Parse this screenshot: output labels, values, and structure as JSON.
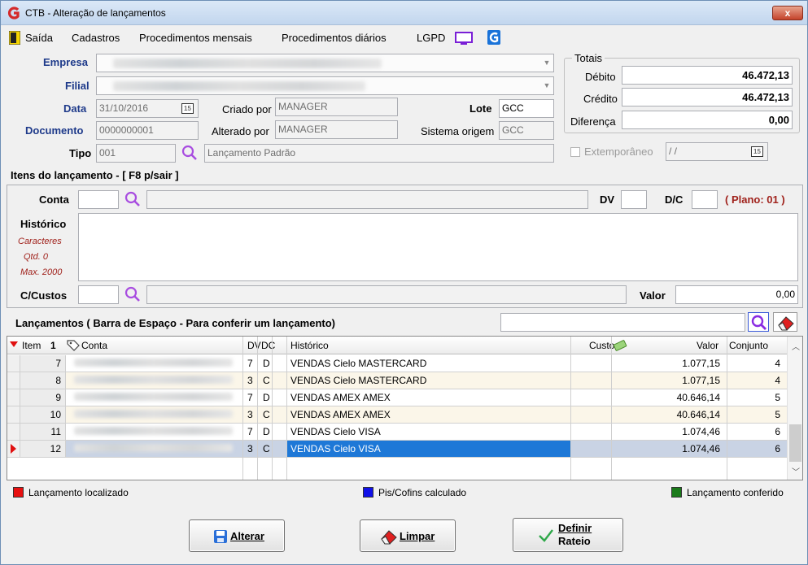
{
  "window": {
    "title": "CTB - Alteração de lançamentos",
    "close_glyph": "x"
  },
  "menu": [
    "Saída",
    "Cadastros",
    "Procedimentos mensais",
    "Procedimentos diários",
    "LGPD"
  ],
  "header": {
    "empresa_label": "Empresa",
    "filial_label": "Filial",
    "data_label": "Data",
    "data_value": "31/10/2016",
    "calendar_glyph": "15",
    "criado_por_label": "Criado por",
    "criado_por_value": "MANAGER",
    "alterado_por_label": "Alterado por",
    "alterado_por_value": "MANAGER",
    "lote_label": "Lote",
    "lote_value": "GCC",
    "sistema_origem_label": "Sistema origem",
    "sistema_origem_value": "GCC",
    "documento_label": "Documento",
    "documento_value": "0000000001",
    "tipo_label": "Tipo",
    "tipo_code": "001",
    "tipo_desc": "Lançamento Padrão"
  },
  "totais": {
    "label": "Totais",
    "debito_label": "Débito",
    "debito_value": "46.472,13",
    "credito_label": "Crédito",
    "credito_value": "46.472,13",
    "diferenca_label": "Diferença",
    "diferenca_value": "0,00",
    "extemporaneo_label": "Extemporâneo",
    "extemporaneo_date": "/ /"
  },
  "itens": {
    "section_title": "Itens do lançamento - [ F8 p/sair ]",
    "conta_label": "Conta",
    "dv_label": "DV",
    "dc_label": "D/C",
    "plano_label": "( Plano: 01 )",
    "historico_label": "Histórico",
    "caracteres_label": "Caracteres",
    "qtd_label": "Qtd. 0",
    "max_label": "Max. 2000",
    "ccustos_label": "C/Custos",
    "valor_label": "Valor",
    "valor_value": "0,00"
  },
  "lancamentos": {
    "section_title": "Lançamentos ( Barra de Espaço - Para conferir um lançamento)",
    "columns": {
      "item": "Item",
      "sort": "1",
      "conta": "Conta",
      "dv": "DV",
      "dc": "DC",
      "historico": "Histórico",
      "custo": "Custo",
      "valor": "Valor",
      "conjunto": "Conjunto"
    },
    "rows": [
      {
        "item": "7",
        "dv": "7",
        "dc": "D",
        "historico": "VENDAS Cielo MASTERCARD",
        "valor": "1.077,15",
        "conjunto": "4"
      },
      {
        "item": "8",
        "dv": "3",
        "dc": "C",
        "historico": "VENDAS Cielo MASTERCARD",
        "valor": "1.077,15",
        "conjunto": "4"
      },
      {
        "item": "9",
        "dv": "7",
        "dc": "D",
        "historico": "VENDAS AMEX AMEX",
        "valor": "40.646,14",
        "conjunto": "5"
      },
      {
        "item": "10",
        "dv": "3",
        "dc": "C",
        "historico": "VENDAS AMEX AMEX",
        "valor": "40.646,14",
        "conjunto": "5"
      },
      {
        "item": "11",
        "dv": "7",
        "dc": "D",
        "historico": "VENDAS Cielo VISA",
        "valor": "1.074,46",
        "conjunto": "6"
      },
      {
        "item": "12",
        "dv": "3",
        "dc": "C",
        "historico": "VENDAS Cielo VISA",
        "valor": "1.074,46",
        "conjunto": "6"
      }
    ],
    "selected_item": "12"
  },
  "legend": {
    "localizado": "Lançamento localizado",
    "pis_cofins": "Pis/Cofins calculado",
    "conferido": "Lançamento conferido",
    "colors": {
      "red": "#e81010",
      "blue": "#1010e8",
      "green": "#1a7a1a"
    }
  },
  "buttons": {
    "alterar": "Alterar",
    "limpar": "Limpar",
    "definir_line1": "Definir",
    "definir_line2": "Rateio"
  }
}
